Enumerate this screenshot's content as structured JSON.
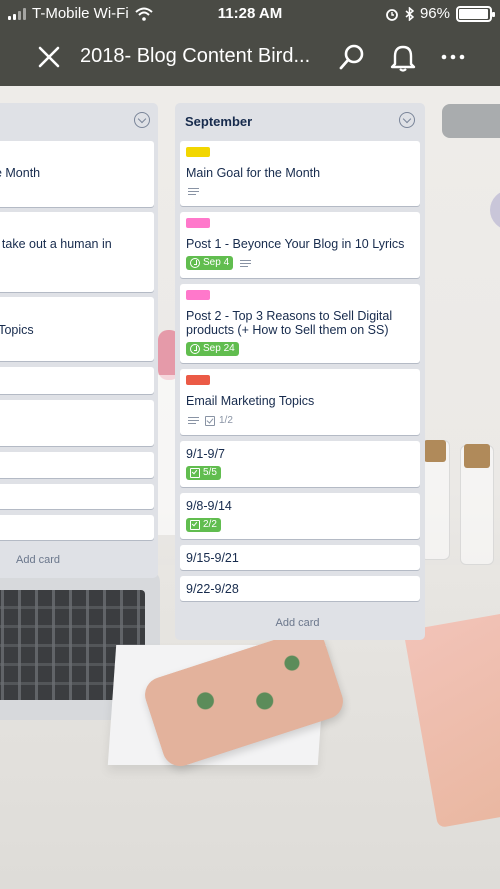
{
  "status_bar": {
    "carrier": "T-Mobile Wi-Fi",
    "time": "11:28 AM",
    "battery": "96%",
    "battery_level": 0.96
  },
  "header": {
    "title": "2018- Blog Content Bird...",
    "icons": [
      "close-icon",
      "search-icon",
      "bell-icon",
      "more-icon"
    ]
  },
  "left_list": {
    "cards": [
      "he Month",
      "to take out a human in\ns",
      "g Topics",
      "",
      "",
      "",
      "",
      ""
    ],
    "add_card": "Add card"
  },
  "september_list": {
    "name": "September",
    "add_card": "Add card",
    "cards": [
      {
        "label_color": "#f2d600",
        "text": "Main Goal for the Month",
        "badges": {
          "description": true
        }
      },
      {
        "label_color": "#ff78cb",
        "text": "Post 1 - Beyonce Your Blog in 10 Lyrics",
        "badges": {
          "due": "Sep 4",
          "description": true
        }
      },
      {
        "label_color": "#ff78cb",
        "text": "Post 2 - Top 3 Reasons to Sell Digital products (+ How to Sell them on SS)",
        "badges": {
          "due": "Sep 24"
        }
      },
      {
        "label_color": "#eb5a46",
        "text": "Email Marketing Topics",
        "badges": {
          "description": true,
          "checklist": "1/2"
        }
      },
      {
        "text": "9/1-9/7",
        "badges": {
          "checklist_complete": "5/5"
        }
      },
      {
        "text": "9/8-9/14",
        "badges": {
          "checklist_complete": "2/2"
        }
      },
      {
        "text": "9/15-9/21"
      },
      {
        "text": "9/22-9/28"
      }
    ]
  },
  "colors": {
    "header_bg": "#4a4b45",
    "list_bg": "#dfe1e6",
    "badge_green": "#61bd4f"
  }
}
